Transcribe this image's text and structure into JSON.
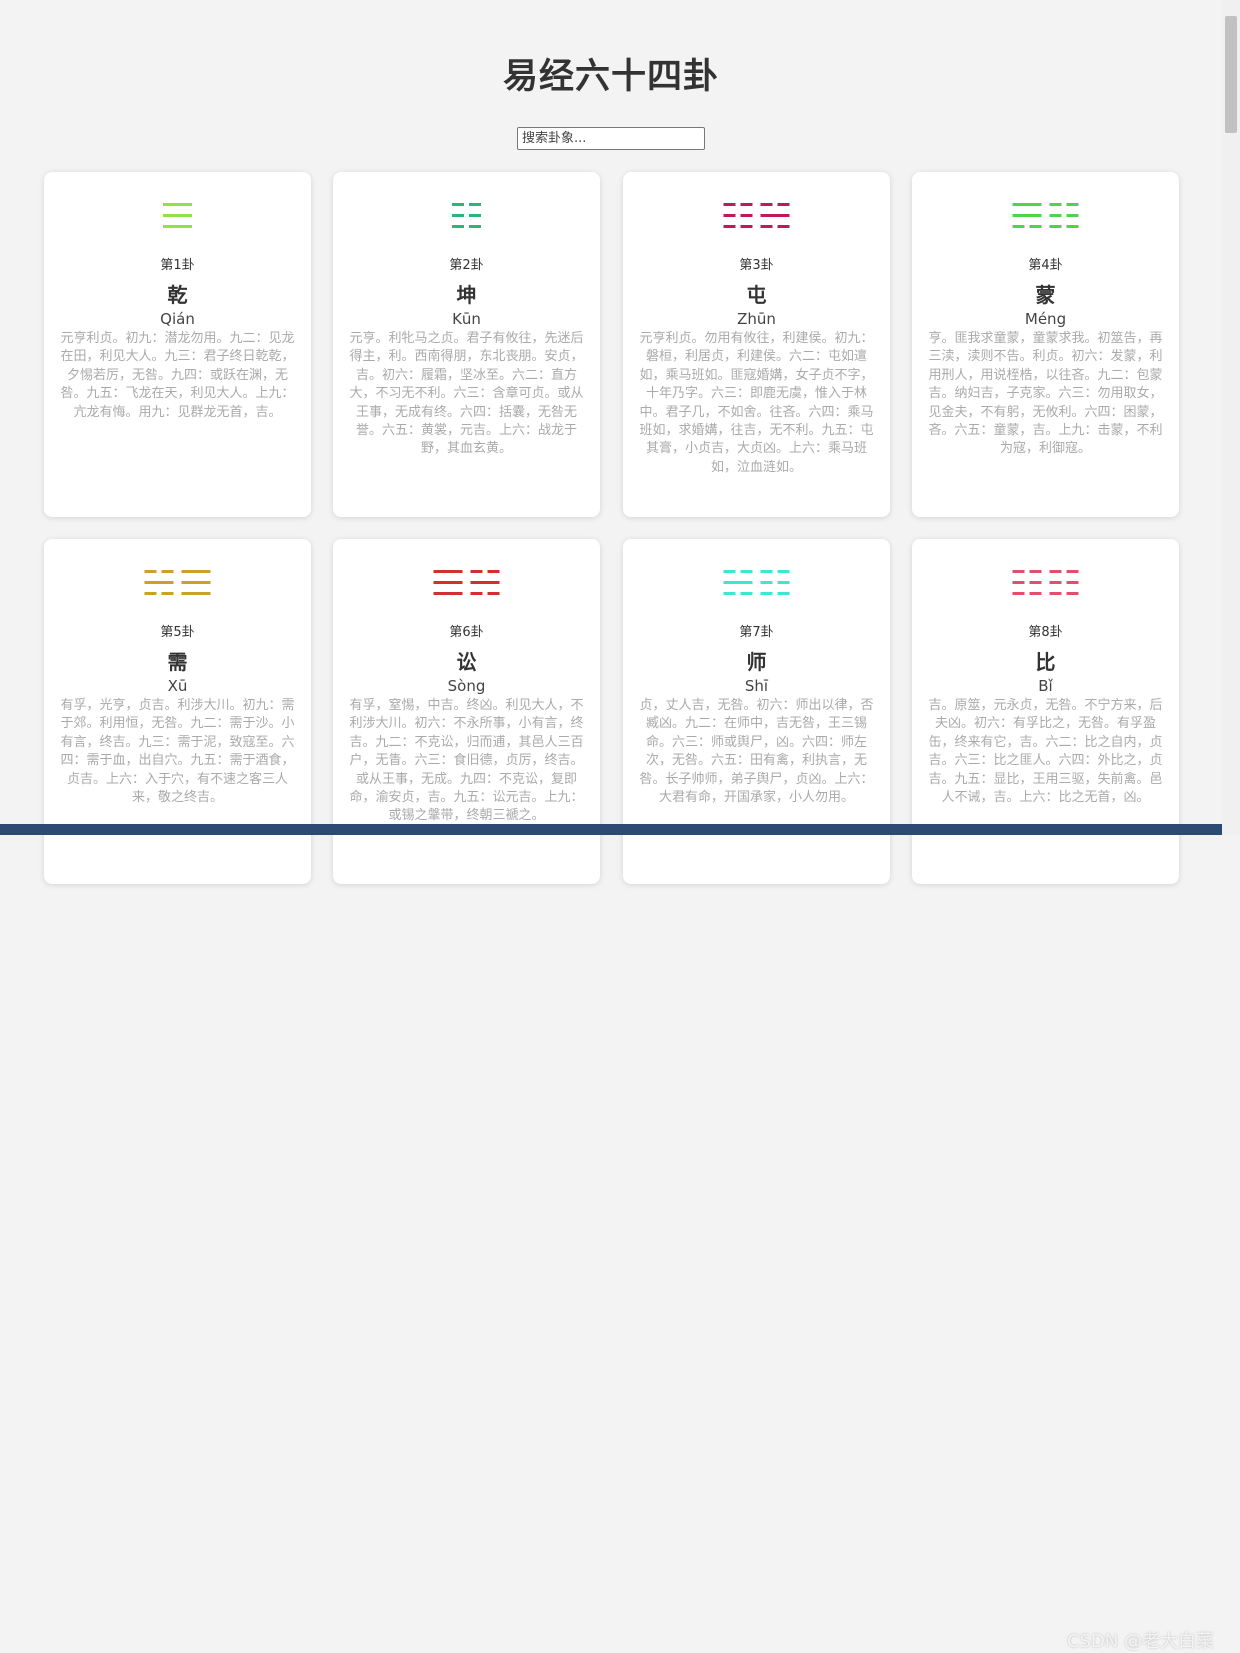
{
  "page": {
    "title": "易经六十四卦",
    "search_placeholder": "搜索卦象..."
  },
  "hexagrams": [
    {
      "number_label": "第1卦",
      "name": "乾",
      "pinyin": "Qián",
      "color": "#8ee24a",
      "lines": [
        1,
        1,
        1
      ],
      "text": "元亨利贞。初九：潜龙勿用。九二：见龙在田，利见大人。九三：君子终日乾乾，夕惕若厉，无咎。九四：或跃在渊，无咎。九五：飞龙在天，利见大人。上九：亢龙有悔。用九：见群龙无首，吉。"
    },
    {
      "number_label": "第2卦",
      "name": "坤",
      "pinyin": "Kūn",
      "color": "#2bb57a",
      "lines": [
        0,
        0,
        0
      ],
      "text": "元亨。利牝马之贞。君子有攸往，先迷后得主，利。西南得朋，东北丧朋。安贞，吉。初六：履霜，坚冰至。六二：直方大，不习无不利。六三：含章可贞。或从王事，无成有终。六四：括囊，无咎无誉。六五：黄裳，元吉。上六：战龙于野，其血玄黄。"
    },
    {
      "number_label": "第3卦",
      "name": "屯",
      "pinyin": "Zhūn",
      "color": "#c2185b",
      "lines": [
        0,
        0,
        0,
        0,
        1,
        0
      ],
      "text": "元亨利贞。勿用有攸往，利建侯。初九：磐桓，利居贞，利建侯。六二：屯如邅如，乘马班如。匪寇婚媾，女子贞不字，十年乃字。六三：即鹿无虞，惟入于林中。君子几，不如舍。往吝。六四：乘马班如，求婚媾，往吉，无不利。九五：屯其膏，小贞吉，大贞凶。上六：乘马班如，泣血涟如。"
    },
    {
      "number_label": "第4卦",
      "name": "蒙",
      "pinyin": "Méng",
      "color": "#4cd44a",
      "lines": [
        1,
        1,
        0,
        0,
        0,
        0
      ],
      "text": "亨。匪我求童蒙，童蒙求我。初筮告，再三渎，渎则不告。利贞。初六：发蒙，利用刑人，用说桎梏，以往吝。九二：包蒙吉。纳妇吉，子克家。六三：勿用取女，见金夫，不有躬，无攸利。六四：困蒙，吝。六五：童蒙，吉。上九：击蒙，不利为寇，利御寇。"
    },
    {
      "number_label": "第5卦",
      "name": "需",
      "pinyin": "Xū",
      "color": "#c9a227",
      "lines": [
        0,
        1,
        0,
        1,
        1,
        1
      ],
      "text": "有孚，光亨，贞吉。利涉大川。初九：需于郊。利用恒，无咎。九二：需于沙。小有言，终吉。九三：需于泥，致寇至。六四：需于血，出自穴。九五：需于酒食，贞吉。上六：入于穴，有不速之客三人来，敬之终吉。"
    },
    {
      "number_label": "第6卦",
      "name": "讼",
      "pinyin": "Sòng",
      "color": "#d32f2f",
      "lines": [
        1,
        1,
        1,
        0,
        1,
        0
      ],
      "text": "有孚，窒惕，中吉。终凶。利见大人，不利涉大川。初六：不永所事，小有言，终吉。九二：不克讼，归而逋，其邑人三百户，无眚。六三：食旧德，贞厉，终吉。或从王事，无成。九四：不克讼，复即命，渝安贞，吉。九五：讼元吉。上九：或锡之鞶带，终朝三褫之。"
    },
    {
      "number_label": "第7卦",
      "name": "师",
      "pinyin": "Shī",
      "color": "#3ee6cf",
      "lines": [
        0,
        1,
        0,
        0,
        0,
        0
      ],
      "text": "贞，丈人吉，无咎。初六：师出以律，否臧凶。九二：在师中，吉无咎，王三锡命。六三：师或舆尸，凶。六四：师左次，无咎。六五：田有禽，利执言，无咎。长子帅师，弟子舆尸，贞凶。上六：大君有命，开国承家，小人勿用。"
    },
    {
      "number_label": "第8卦",
      "name": "比",
      "pinyin": "Bǐ",
      "color": "#e0506e",
      "lines": [
        0,
        0,
        0,
        0,
        0,
        0
      ],
      "text": "吉。原筮，元永贞，无咎。不宁方来，后夫凶。初六：有孚比之，无咎。有孚盈缶，终来有它，吉。六二：比之自内，贞吉。六三：比之匪人。六四：外比之，贞吉。九五：显比，王用三驱，失前禽。邑人不诫，吉。上六：比之无首，凶。"
    }
  ],
  "watermark": "CSDN @老大白菜"
}
